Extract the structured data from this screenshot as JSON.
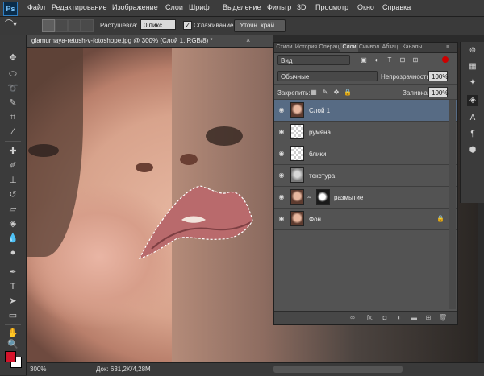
{
  "app": {
    "logo": "Ps"
  },
  "menu": [
    "Файл",
    "Редактирование",
    "Изображение",
    "Слои",
    "Шрифт",
    "Выделение",
    "Фильтр",
    "3D",
    "Просмотр",
    "Окно",
    "Справка"
  ],
  "options": {
    "feather_label": "Растушевка:",
    "feather_value": "0 пикс.",
    "antialias_label": "Сглаживание",
    "antialias_checked": "✓",
    "refine_button": "Уточн. край..."
  },
  "document": {
    "tab_title": "glamurnaya-retush-v-fotoshope.jpg @ 300% (Слой 1, RGB/8) *",
    "close": "×"
  },
  "panel": {
    "tabs": [
      "Стили",
      "История",
      "Операц",
      "Слои",
      "Символ",
      "Абзац",
      "Каналы"
    ],
    "active_tab": "Слои",
    "kind_filter": "Вид",
    "blend_mode": "Обычные",
    "opacity_label": "Непрозрачность:",
    "opacity_value": "100%",
    "lock_label": "Закрепить:",
    "fill_label": "Заливка:",
    "fill_value": "100%",
    "layers": [
      {
        "name": "Слой 1",
        "thumb": "face",
        "selected": true
      },
      {
        "name": "румяна",
        "thumb": "checker",
        "selected": false
      },
      {
        "name": "блики",
        "thumb": "checker",
        "selected": false
      },
      {
        "name": "текстура",
        "thumb": "mono",
        "selected": false
      },
      {
        "name": "размытие",
        "thumb": "face",
        "selected": false,
        "mask": true
      },
      {
        "name": "Фон",
        "thumb": "face",
        "selected": false,
        "locked": true
      }
    ],
    "bottom_icons": [
      "link-icon",
      "fx-icon",
      "mask-icon",
      "adjustment-icon",
      "folder-icon",
      "new-layer-icon",
      "trash-icon"
    ],
    "bottom_fx_label": "fx."
  },
  "status": {
    "zoom": "300%",
    "doc_info": "Док: 631,2K/4,28M"
  },
  "colors": {
    "foreground": "#d4132a",
    "background": "#ffffff",
    "selected_layer": "#576b84"
  }
}
